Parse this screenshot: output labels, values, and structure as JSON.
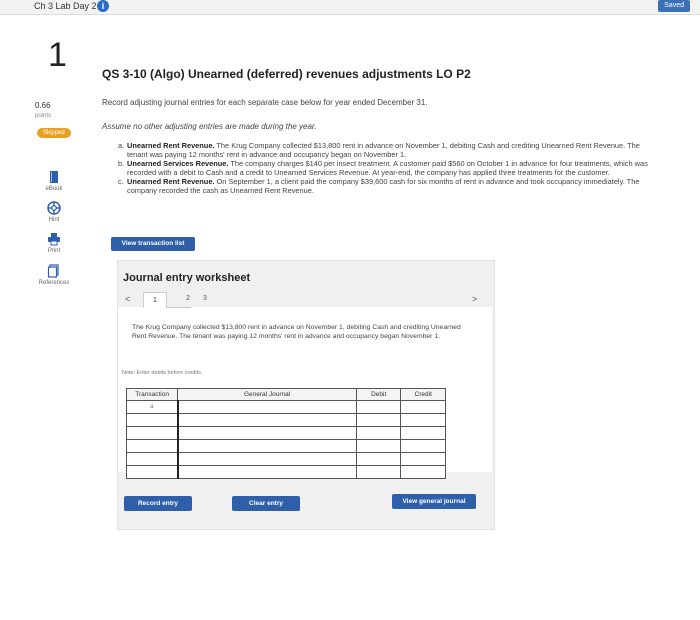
{
  "header": {
    "title": "Ch 3 Lab Day 2",
    "saved_label": "Saved"
  },
  "sidebar": {
    "question_number": "1",
    "points_value": "0.66",
    "points_label": "points",
    "status_badge": "Skipped",
    "tools": [
      {
        "icon": "ebook-icon",
        "label": "eBook"
      },
      {
        "icon": "hint-icon",
        "label": "Hint"
      },
      {
        "icon": "print-icon",
        "label": "Print"
      },
      {
        "icon": "references-icon",
        "label": "References"
      }
    ]
  },
  "question": {
    "heading": "QS 3-10 (Algo) Unearned (deferred) revenues adjustments LO P2",
    "instruction": "Record adjusting journal entries for each separate case below for year ended December 31.",
    "assumption": "Assume no other adjusting entries are made during the year.",
    "cases": [
      {
        "letter": "a.",
        "title": "Unearned Rent Revenue.",
        "text": "The Krug Company collected $13,800 rent in advance on November 1, debiting Cash and crediting Unearned Rent Revenue. The tenant was paying 12 months' rent in advance and occupancy began on November 1."
      },
      {
        "letter": "b.",
        "title": "Unearned Services Revenue.",
        "text": "The company charges $140 per insect treatment. A customer paid $560 on October 1 in advance for four treatments, which was recorded with a debit to Cash and a credit to Unearned Services Revenue. At year-end, the company has applied three treatments for the customer."
      },
      {
        "letter": "c.",
        "title": "Unearned Rent Revenue.",
        "text": "On September 1, a client paid the company $39,600 cash for six months of rent in advance and took occupancy immediately. The company recorded the cash as Unearned Rent Revenue."
      }
    ],
    "view_transaction_button": "View transaction list"
  },
  "worksheet": {
    "title": "Journal entry worksheet",
    "prev": "<",
    "next": ">",
    "tabs": [
      "1",
      "2",
      "3"
    ],
    "description": "The Krug Company collected $13,800 rent in advance on November 1, debiting Cash and crediting Unearned Rent Revenue. The tenant was paying 12 months' rent in advance and occupancy began November 1.",
    "note": "Note: Enter debits before credits.",
    "columns": [
      "Transaction",
      "General Journal",
      "Debit",
      "Credit"
    ],
    "rows": [
      {
        "transaction": "a"
      },
      {
        "transaction": ""
      },
      {
        "transaction": ""
      },
      {
        "transaction": ""
      },
      {
        "transaction": ""
      },
      {
        "transaction": ""
      }
    ],
    "record_button": "Record entry",
    "clear_button": "Clear entry",
    "view_journal_button": "View general journal"
  },
  "colors": {
    "accent": "#2f5fa8",
    "skipped": "#e8a020"
  }
}
